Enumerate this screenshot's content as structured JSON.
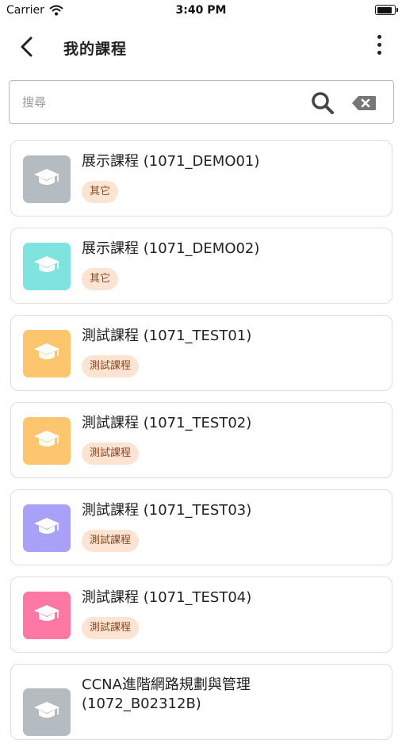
{
  "status_bar": {
    "carrier": "Carrier",
    "time": "3:40 PM"
  },
  "header": {
    "title": "我的課程",
    "back_icon": "chevron-left-icon",
    "more_icon": "more-vertical-icon"
  },
  "search": {
    "placeholder": "搜尋",
    "value": "",
    "search_icon": "search-icon",
    "clear_icon": "backspace-icon"
  },
  "courses": [
    {
      "name": "展示課程 (1071_DEMO01)",
      "tag": "其它",
      "color": "#b5bcc1"
    },
    {
      "name": "展示課程 (1071_DEMO02)",
      "tag": "其它",
      "color": "#7fe4e0"
    },
    {
      "name": "測試課程 (1071_TEST01)",
      "tag": "測試課程",
      "color": "#fdc66e"
    },
    {
      "name": "測試課程 (1071_TEST02)",
      "tag": "測試課程",
      "color": "#fdc66e"
    },
    {
      "name": "測試課程 (1071_TEST03)",
      "tag": "測試課程",
      "color": "#a9a0f7"
    },
    {
      "name": "測試課程 (1071_TEST04)",
      "tag": "測試課程",
      "color": "#fd78a3"
    },
    {
      "name": "CCNA進階網路規劃與管理\n(1072_B02312B)",
      "tag": "",
      "color": "#b5bcc1"
    }
  ],
  "course_icon": "graduation-cap-icon"
}
